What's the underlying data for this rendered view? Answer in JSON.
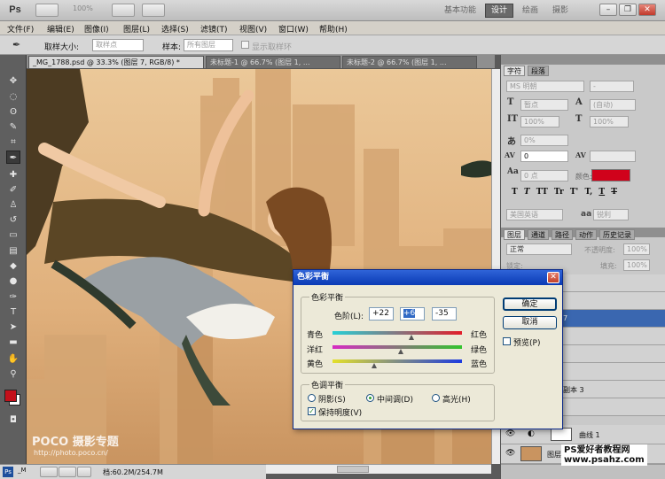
{
  "appbar": {
    "logo": "Ps",
    "zoom": "100%",
    "workspaces": [
      "基本功能",
      "设计",
      "绘画",
      "摄影"
    ],
    "active_workspace": "设计"
  },
  "menu": [
    "文件(F)",
    "编辑(E)",
    "图像(I)",
    "图层(L)",
    "选择(S)",
    "滤镜(T)",
    "视图(V)",
    "窗口(W)",
    "帮助(H)"
  ],
  "options": {
    "sample_size_label": "取样大小:",
    "sample_size_value": "取样点",
    "sample_label": "样本:",
    "sample_value": "所有图层",
    "show_ring_label": "显示取样环"
  },
  "tabs": [
    "_MG_1788.psd @ 33.3% (图层 7, RGB/8) *",
    "未标题-1 @ 66.7% (图层 1, ...",
    "未标题-2 @ 66.7% (图层 1, ..."
  ],
  "status": {
    "doc_size": "档:60.2M/254.7M"
  },
  "watermark": {
    "logo": "POCO 摄影专题",
    "url": "http://photo.poco.cn/"
  },
  "site_watermark": {
    "title": "PS爱好者教程网",
    "url": "www.psahz.com"
  },
  "character_panel": {
    "tabs": [
      "字符",
      "段落"
    ],
    "font_family": "MS 明朝",
    "font_style": "-",
    "font_size": "暂点",
    "leading": "(自动)",
    "vertical_scale": "100%",
    "horizontal_scale": "100%",
    "tsume": "0%",
    "tracking": "0",
    "baseline": "0 点",
    "color_label": "颜色:",
    "color": "#d0021b",
    "language": "美国英语",
    "antialias_label": "aa",
    "antialias": "锐利"
  },
  "layers_panel": {
    "tabs": [
      "图层",
      "通道",
      "路径",
      "动作",
      "历史记录"
    ],
    "blend_mode": "正常",
    "opacity_label": "不透明度:",
    "opacity": "100%",
    "lock_label": "锁定:",
    "fill_label": "填充:",
    "fill": "100%",
    "visible_rows": [
      {
        "name": "副本 3"
      },
      {
        "name": "曲线 1"
      },
      {
        "name": "图层"
      }
    ]
  },
  "dialog": {
    "title": "色彩平衡",
    "group1_label": "色彩平衡",
    "levels_label": "色阶(L):",
    "levels": [
      "+22",
      "+6",
      "-35"
    ],
    "sliders": [
      {
        "left": "青色",
        "right": "红色",
        "value": 22
      },
      {
        "left": "洋红",
        "right": "绿色",
        "value": 6
      },
      {
        "left": "黄色",
        "right": "蓝色",
        "value": -35
      }
    ],
    "group2_label": "色调平衡",
    "tones": [
      "阴影(S)",
      "中间调(D)",
      "高光(H)"
    ],
    "selected_tone": "中间调(D)",
    "preserve_label": "保持明度(V)",
    "preserve_checked": true,
    "ok_label": "确定",
    "cancel_label": "取消",
    "preview_label": "预览(P)",
    "preview_checked": false
  }
}
